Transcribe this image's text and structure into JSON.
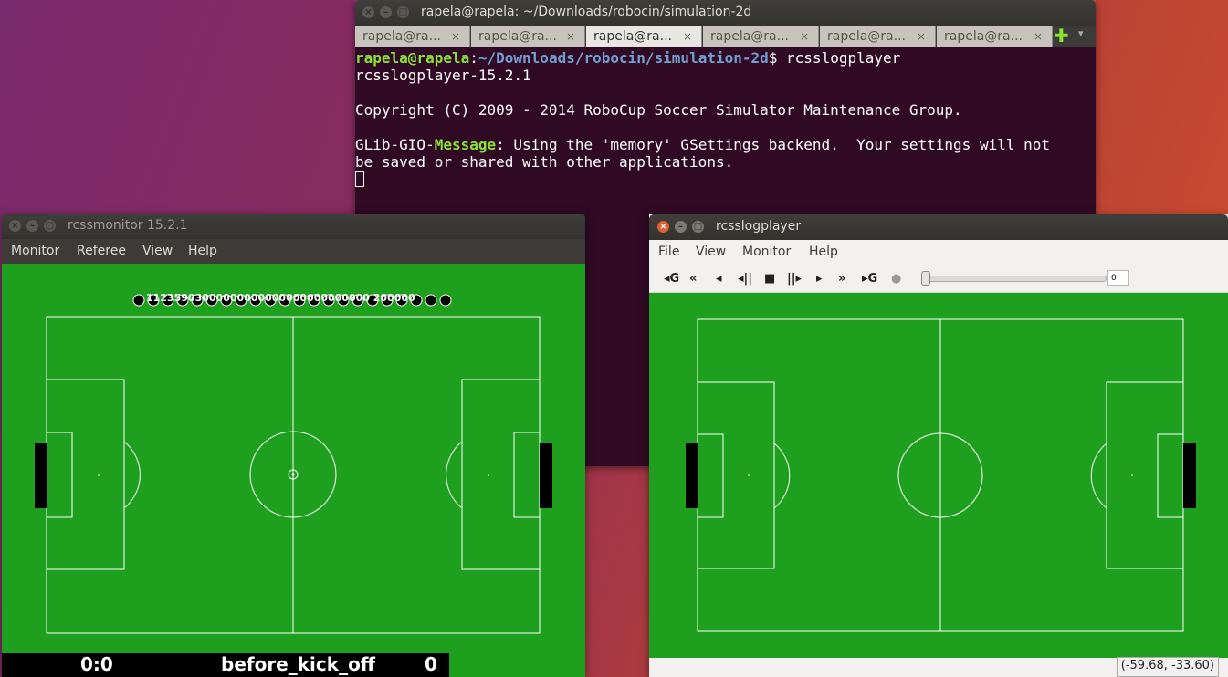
{
  "terminal": {
    "title": "rapela@rapela: ~/Downloads/robocin/simulation-2d",
    "tabs": [
      "rapela@ra...",
      "rapela@ra...",
      "rapela@ra...",
      "rapela@ra...",
      "rapela@ra...",
      "rapela@ra..."
    ],
    "active_tab": 2,
    "prompt_user": "rapela@rapela",
    "prompt_path": "~/Downloads/robocin/simulation-2d",
    "prompt_suffix": "$ rcsslogplayer",
    "lines": [
      "rcsslogplayer-15.2.1",
      "",
      "Copyright (C) 2009 - 2014 RoboCup Soccer Simulator Maintenance Group."
    ],
    "glib_prefix": "GLib-GIO-",
    "glib_word": "Message",
    "glib_rest": ": Using the 'memory' GSettings backend.  Your settings will not",
    "glib_rest2": "be saved or shared with other applications."
  },
  "monitor": {
    "title": "rcssmonitor 15.2.1",
    "menu": [
      "Monitor",
      "Referee",
      "View",
      "Help"
    ],
    "score": "0:0",
    "play_mode": "before_kick_off",
    "time": "0",
    "player_labels_text": "11235903000000000000000000000000 200000"
  },
  "logplayer": {
    "title": "rcsslogplayer",
    "menu": [
      "File",
      "View",
      "Monitor",
      "Help"
    ],
    "toolbar_icons": [
      "go-first-icon",
      "rewind-icon",
      "step-back-icon",
      "play-back-icon",
      "stop-icon",
      "play-forward-icon",
      "step-forward-icon",
      "fast-forward-icon",
      "go-last-icon",
      "record-icon"
    ],
    "toolbar_glyphs": [
      "◂G",
      "«",
      "◂",
      "◂||",
      "■",
      "||▸",
      "▸",
      "»",
      "▸G",
      "●"
    ],
    "cycle_value": "0",
    "coordinates": "(-59.68, -33.60)"
  },
  "colors": {
    "pitch": "#1ea01e",
    "terminal_bg": "#300a24",
    "close_active": "#e35d34"
  }
}
